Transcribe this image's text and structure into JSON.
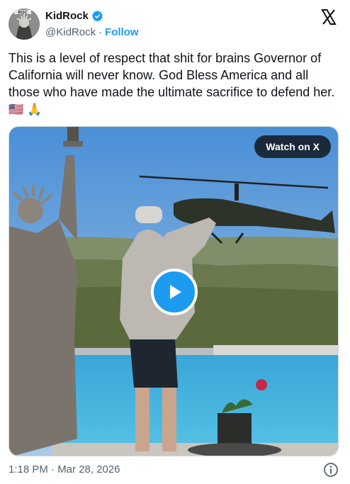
{
  "author": {
    "display_name": "KidRock",
    "handle": "@KidRock",
    "separator": "·",
    "follow_label": "Follow",
    "verified_icon": "verified-badge-icon",
    "avatar_text": "ROC"
  },
  "brand_icon": "x-logo-icon",
  "tweet": {
    "text": "This is a level of respect that shit for brains Governor of California will never know. God Bless America and all those who have made the ultimate sacrifice to defend her.",
    "emoji_flag": "🇺🇸",
    "emoji_pray": "🙏"
  },
  "media": {
    "watch_label": "Watch on X",
    "play_icon": "play-icon"
  },
  "footer": {
    "timestamp": "1:18 PM · Mar 28, 2026",
    "info_icon": "info-icon"
  },
  "colors": {
    "accent": "#1d9bf0",
    "text": "#0f1419",
    "secondary": "#536471"
  }
}
